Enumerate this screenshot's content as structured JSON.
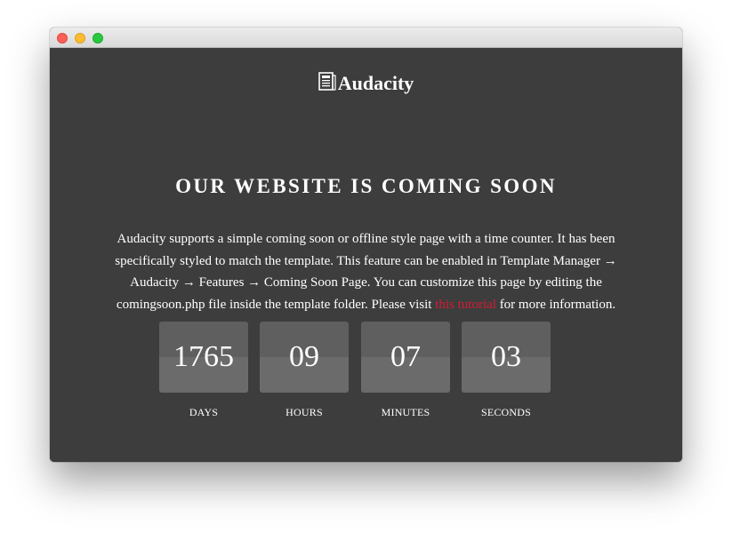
{
  "brand": {
    "name": "Audacity",
    "icon": "newspaper-icon"
  },
  "heading": "OUR WEBSITE IS COMING SOON",
  "description": {
    "before_link": "Audacity supports a simple coming soon or offline style page with a time counter. It has been specifically styled to match the template. This feature can be enabled in Template Manager → Audacity → Features → Coming Soon Page. You can customize this page by editing the comingsoon.php file inside the template folder. Please visit ",
    "link_text": "this tutorial",
    "after_link": " for more information."
  },
  "countdown": [
    {
      "value": "1765",
      "label": "DAYS"
    },
    {
      "value": "09",
      "label": "HOURS"
    },
    {
      "value": "07",
      "label": "MINUTES"
    },
    {
      "value": "03",
      "label": "SECONDS"
    }
  ],
  "colors": {
    "background": "#3d3d3d",
    "counter_box": "#5f5f5f",
    "link": "#d31c35",
    "text": "#ffffff"
  }
}
